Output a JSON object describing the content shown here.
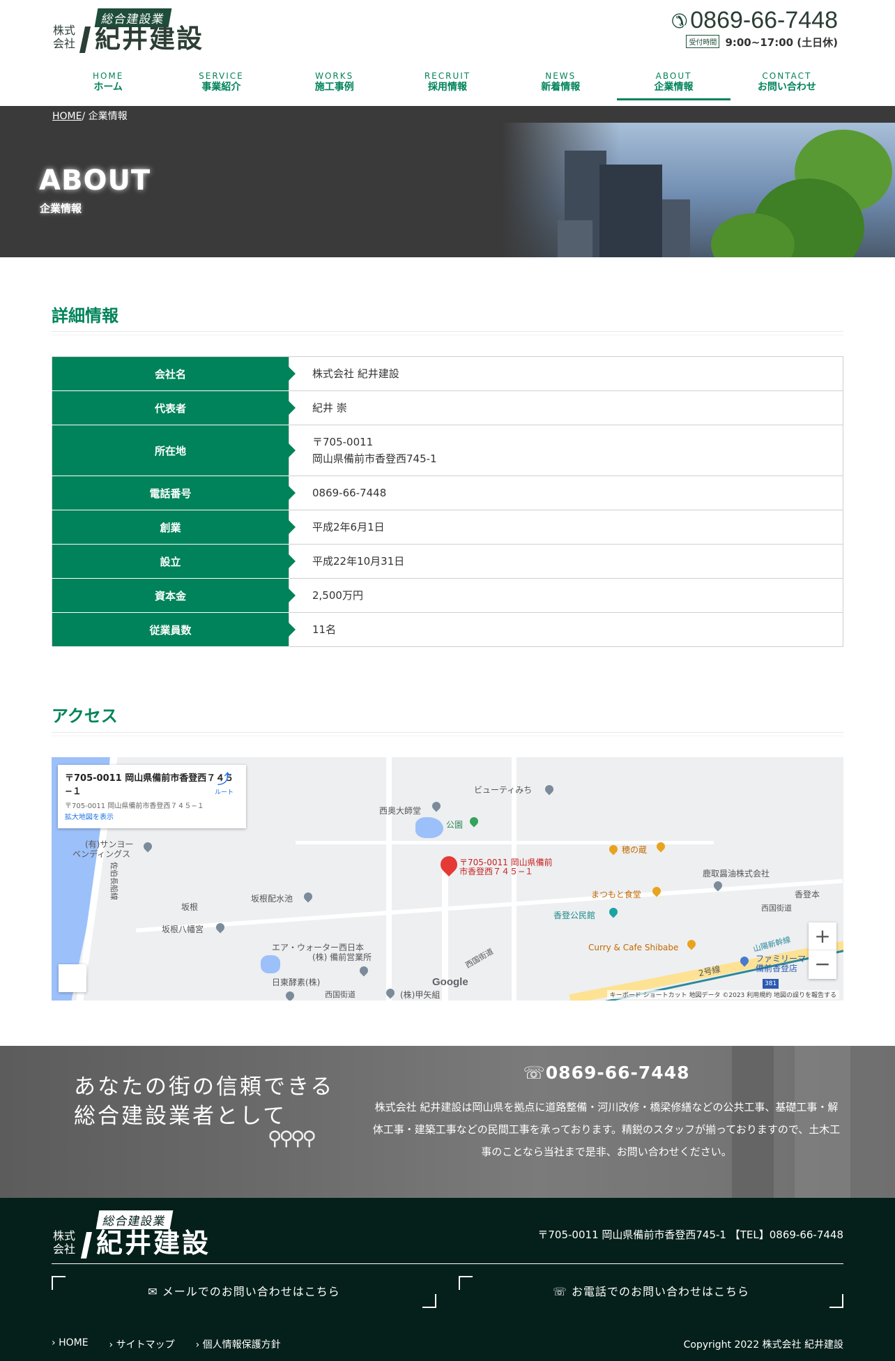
{
  "header": {
    "logo_sub": "総合建設業",
    "logo_kk": "株式会社",
    "logo_name": "紀井建設",
    "tel": "0869-66-7448",
    "hours_badge": "受付時間",
    "hours": "9:00~17:00 (土日休)"
  },
  "nav": [
    {
      "en": "HOME",
      "ja": "ホーム"
    },
    {
      "en": "SERVICE",
      "ja": "事業紹介"
    },
    {
      "en": "WORKS",
      "ja": "施工事例"
    },
    {
      "en": "RECRUIT",
      "ja": "採用情報"
    },
    {
      "en": "NEWS",
      "ja": "新着情報"
    },
    {
      "en": "ABOUT",
      "ja": "企業情報"
    },
    {
      "en": "CONTACT",
      "ja": "お問い合わせ"
    }
  ],
  "hero": {
    "breadcrumb_home": "HOME",
    "breadcrumb_sep": "/",
    "breadcrumb_current": "企業情報",
    "title": "ABOUT",
    "subtitle": "企業情報"
  },
  "details": {
    "heading": "詳細情報",
    "rows": [
      {
        "label": "会社名",
        "value": "株式会社 紀井建設"
      },
      {
        "label": "代表者",
        "value": "紀井 崇"
      },
      {
        "label": "所在地",
        "value": "〒705-0011",
        "value2": "岡山県備前市香登西745-1"
      },
      {
        "label": "電話番号",
        "value": "0869-66-7448"
      },
      {
        "label": "創業",
        "value": "平成2年6月1日"
      },
      {
        "label": "設立",
        "value": "平成22年10月31日"
      },
      {
        "label": "資本金",
        "value": "2,500万円"
      },
      {
        "label": "従業員数",
        "value": "11名"
      }
    ]
  },
  "access": {
    "heading": "アクセス",
    "map": {
      "card_title": "〒705-0011 岡山県備前市香登西７４５−１",
      "card_sub": "〒705-0011 岡山県備前市香登西７４５−１",
      "card_link": "拡大地図を表示",
      "card_dir": "ルート",
      "pin_label_1": "〒705-0011 岡山県備前",
      "pin_label_2": "市香登西７４５−１",
      "google": "Google",
      "attribution": "キーボード ショートカット  地図データ ©2023  利用規約  地図の誤りを報告する",
      "labels": {
        "beauty": "ビューティみち",
        "nishioku": "西奥大師堂",
        "park": "公園",
        "sanyo1": "(有)サンヨー",
        "sanyo2": "ベンディングス",
        "honokura": "穂の蔵",
        "katori_shoyu": "鹿取醤油株式会社",
        "matsumoto": "まつもと食堂",
        "kagato": "香登本",
        "saka_pond": "坂根配水池",
        "sakane": "坂根",
        "saiseki": "佐伯長船線",
        "community": "香登公民館",
        "saigoku1": "西国街道",
        "sakane_shrine": "坂根八幡宮",
        "air1": "エア・ウォーター西日本",
        "air2": "(株) 備前営業所",
        "curry": "Curry & Cafe Shibabe",
        "sanyo_line": "山陽新幹線",
        "family1": "ファミリーマ",
        "family2": "備前香登店",
        "route2": "2号線",
        "toto": "日東酵素(株)",
        "saigoku2": "西国街道",
        "saigoku3": "西国街道",
        "koyagumi": "(株)甲矢組",
        "route381": "381"
      }
    }
  },
  "band": {
    "catch_1": "あなたの街の信頼できる",
    "catch_2": "総合建設業者として",
    "tel": "0869-66-7448",
    "text": "株式会社 紀井建設は岡山県を拠点に道路整備・河川改修・橋梁修繕などの公共工事、基礎工事・解体工事・建築工事などの民間工事を承っております。精鋭のスタッフが揃っておりますので、土木工事のことなら当社まで是非、お問い合わせください。"
  },
  "footer": {
    "logo_sub": "総合建設業",
    "logo_kk": "株式会社",
    "logo_name": "紀井建設",
    "address": "〒705-0011 岡山県備前市香登西745-1 【TEL】0869-66-7448",
    "mail_button": "メールでのお問い合わせはこちら",
    "tel_button": "お電話でのお問い合わせはこちら",
    "links": [
      "HOME",
      "サイトマップ",
      "個人情報保護方針"
    ],
    "copyright": "Copyright 2022 株式会社 紀井建設"
  },
  "colors": {
    "accent": "#00835a",
    "footer_bg": "#05201a",
    "hero_bg": "#3a3a3a"
  },
  "icons": [
    "phone-icon",
    "directions-icon",
    "pegman-icon",
    "map-pin-icon"
  ]
}
